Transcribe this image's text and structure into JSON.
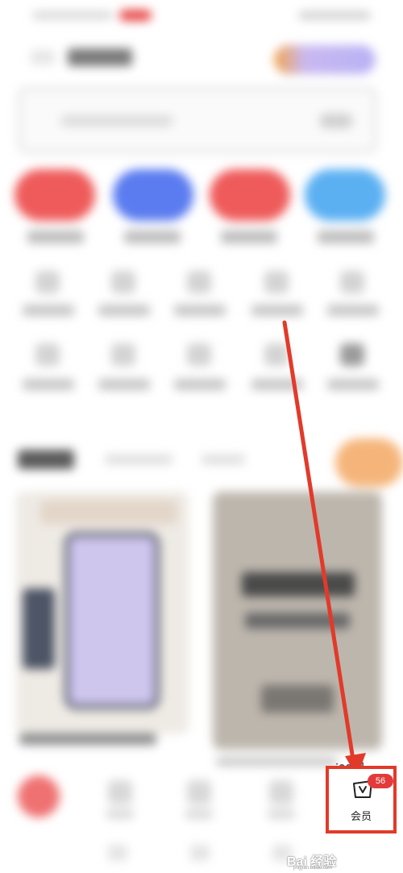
{
  "partial_caption": "i00词",
  "bottom_nav": {
    "member_tab": {
      "label": "会员",
      "badge_count": "56",
      "icon": "shopping-bag-v-icon"
    }
  },
  "annotation": {
    "arrow_color": "#e23a2a",
    "highlight_color": "#e23a2a"
  },
  "watermark": {
    "text": "Bai 经验",
    "url": "jingyan.baidu.com"
  }
}
